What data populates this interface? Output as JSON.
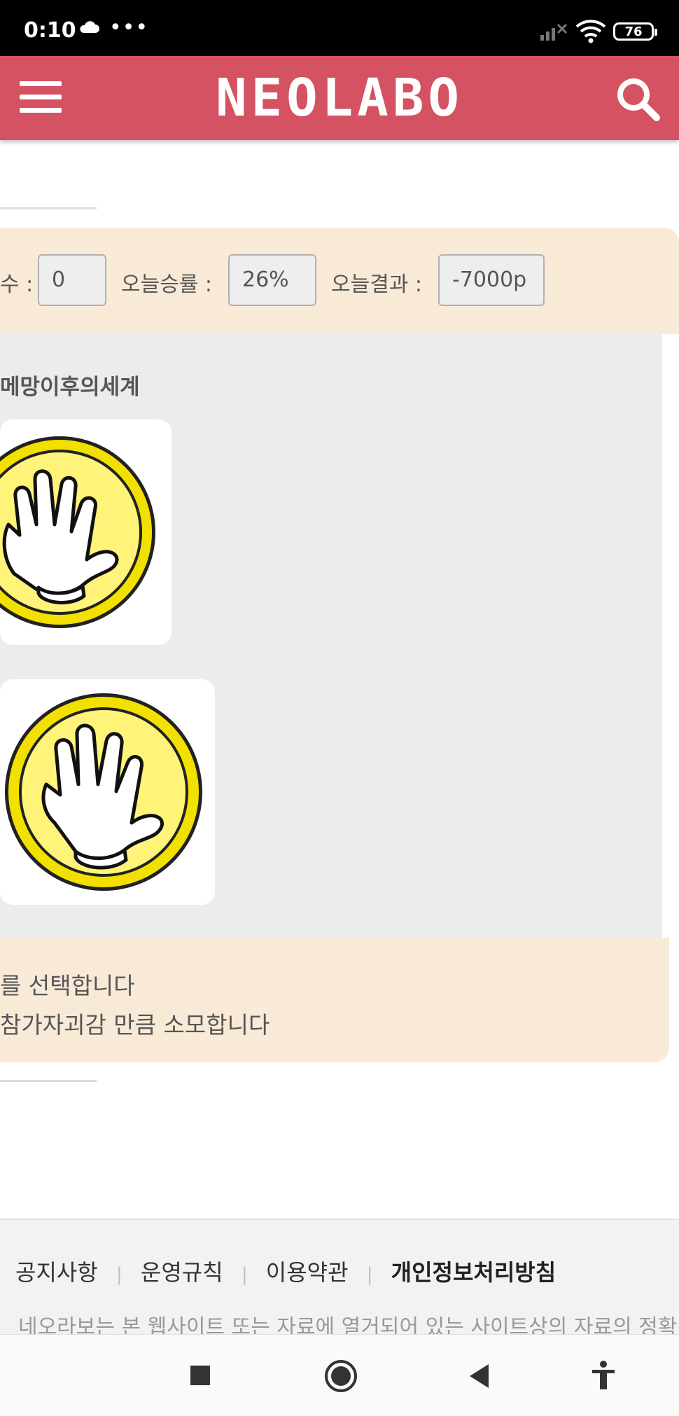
{
  "status_bar": {
    "time": "0:10",
    "dots": "•••",
    "battery": "76",
    "icons": [
      "cloud-icon",
      "signal-off-icon",
      "wifi-icon",
      "battery-icon"
    ]
  },
  "header": {
    "logo": "NEOLABO",
    "menu_icon": "hamburger-menu-icon",
    "search_icon": "search-icon",
    "color": "#d45261"
  },
  "stats": {
    "count_label": "수 :",
    "count_value": "0",
    "winrate_label": "오늘승률 :",
    "winrate_value": "26%",
    "result_label": "오늘결과 :",
    "result_value": "-7000p"
  },
  "game": {
    "title": "메망이후의세계",
    "choices": [
      {
        "icon": "paper-hand-icon"
      },
      {
        "icon": "paper-hand-icon"
      }
    ]
  },
  "messages": {
    "line1": "를 선택합니다",
    "line2": "참가자괴감 만큼 소모합니다"
  },
  "footer": {
    "links": [
      "공지사항",
      "운영규칙",
      "이용약관",
      "개인정보처리방침"
    ],
    "separator": "|",
    "description": "네오라보는 본 웹사이트 또는 자료에 열거되어 있는 사이트상의 자료의 정확"
  },
  "nav_bar": {
    "icons": [
      "recents-square-icon",
      "home-circle-icon",
      "back-triangle-icon",
      "accessibility-icon"
    ]
  }
}
